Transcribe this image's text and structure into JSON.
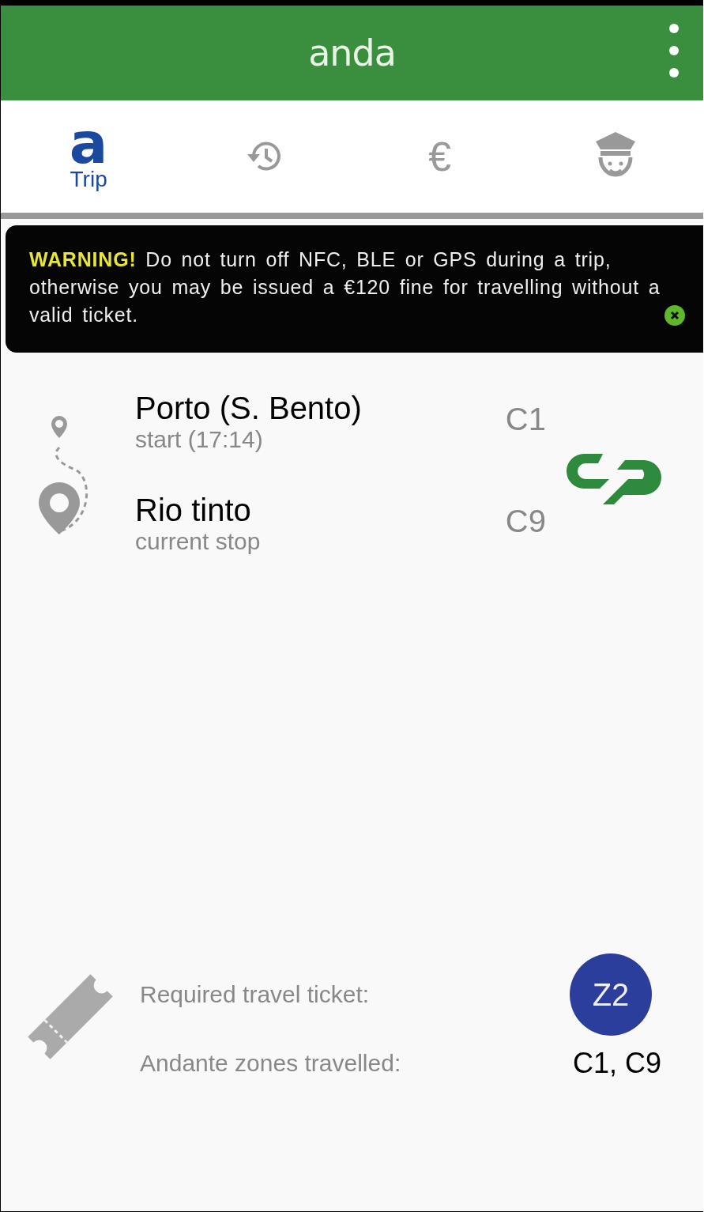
{
  "header": {
    "title": "anda"
  },
  "tabs": [
    {
      "kind": "trip",
      "glyph": "a",
      "label": "Trip",
      "selected": true
    },
    {
      "kind": "history",
      "selected": false
    },
    {
      "kind": "fares",
      "glyph": "€",
      "selected": false
    },
    {
      "kind": "inspector",
      "selected": false
    }
  ],
  "warning": {
    "text": "**WARNING!** Do not turn off NFC, BLE or GPS during a trip, otherwise you may be issued a €120 fine for travelling without a valid ticket."
  },
  "stops": [
    {
      "name": "Porto (S. Bento)",
      "detail": "start (17:14)",
      "zone": "C1"
    },
    {
      "name": "Rio tinto",
      "detail": "current stop",
      "zone": "C9"
    }
  ],
  "ticket": {
    "required_label": "Required travel ticket:",
    "required": "Z2",
    "zones_label": "Andante zones travelled:",
    "zones": "C1, C9"
  }
}
